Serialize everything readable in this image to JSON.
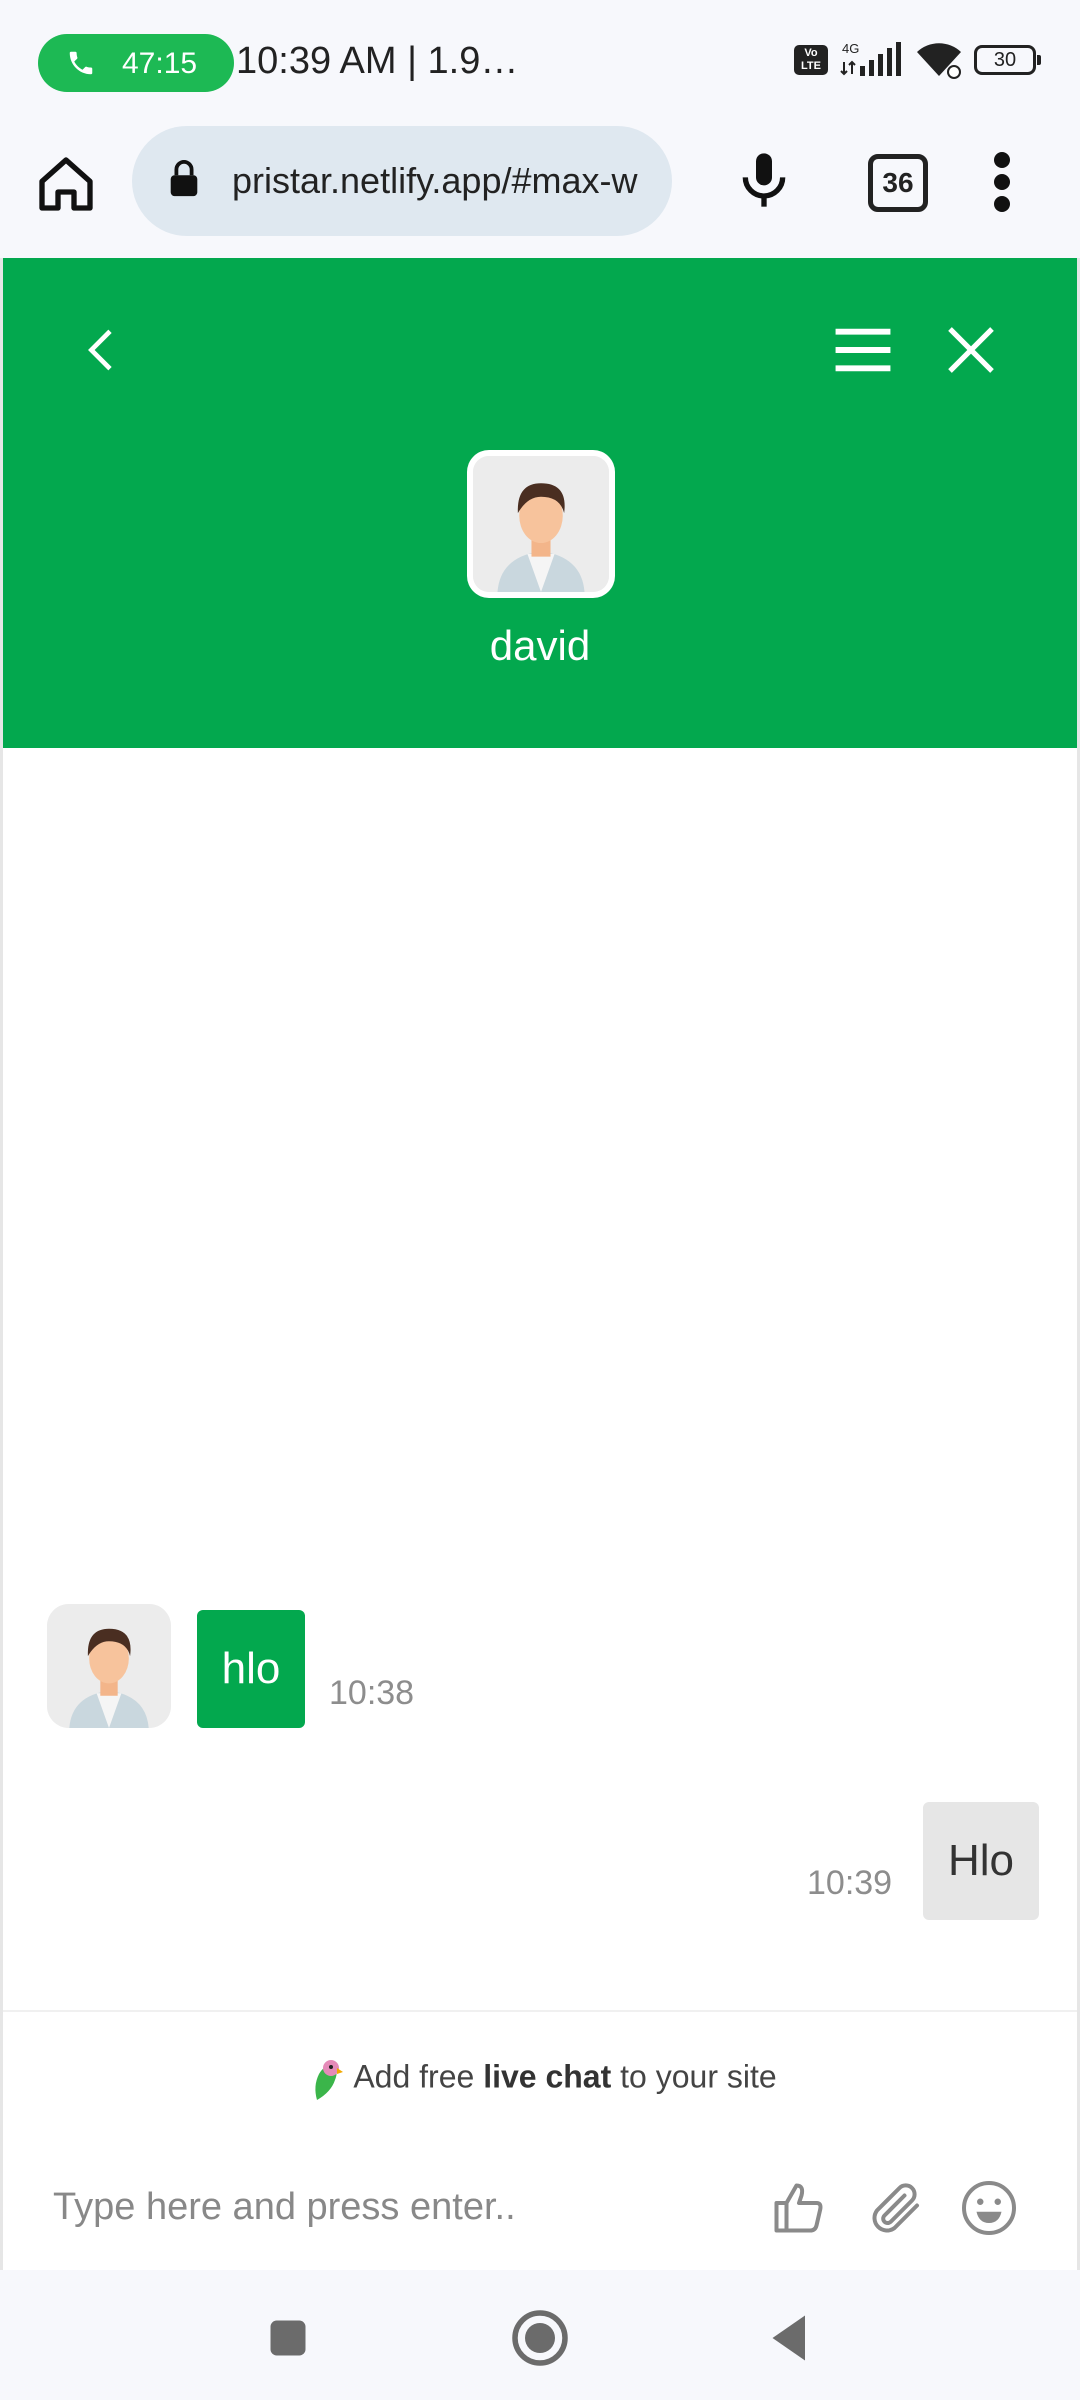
{
  "status_bar": {
    "call_timer": "47:15",
    "time": "10:39 AM | 1.9…",
    "volte": "Vo LTE",
    "network": "4G",
    "battery": "30"
  },
  "browser": {
    "url": "pristar.netlify.app/#max-w",
    "tab_count": "36"
  },
  "chat": {
    "agent_name": "david",
    "messages": [
      {
        "from": "operator",
        "text": "hlo",
        "time": "10:38"
      },
      {
        "from": "visitor",
        "text": "Hlo",
        "time": "10:39"
      }
    ],
    "promo": {
      "prefix": "Add free ",
      "bold": "live chat",
      "suffix": " to your site"
    },
    "input_placeholder": "Type here and press enter.."
  },
  "colors": {
    "header_green": "#03a84e",
    "operator_bubble": "#03a84e",
    "visitor_bubble": "#e6e6e6",
    "call_pill": "#1db954"
  }
}
